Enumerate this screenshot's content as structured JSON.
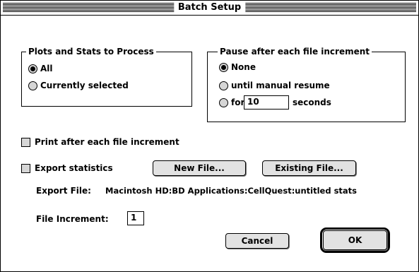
{
  "window": {
    "title": "Batch Setup"
  },
  "plots_group": {
    "legend": "Plots and Stats to Process",
    "options": [
      {
        "label": "All",
        "selected": true
      },
      {
        "label": "Currently selected",
        "selected": false
      }
    ]
  },
  "pause_group": {
    "legend": "Pause after each file increment",
    "none_label": "None",
    "manual_label": "until manual resume",
    "for_label": "for",
    "for_value": "10",
    "seconds_label": "seconds",
    "selected": "None"
  },
  "print_option": {
    "label": "Print after each file increment",
    "checked": false
  },
  "export_option": {
    "label": "Export statistics",
    "checked": false
  },
  "buttons": {
    "new_file": "New File...",
    "existing_file": "Existing File...",
    "cancel": "Cancel",
    "ok": "OK"
  },
  "export_file": {
    "label": "Export File:",
    "path": "Macintosh HD:BD Applications:CellQuest:untitled stats"
  },
  "file_increment": {
    "label": "File Increment:",
    "value": "1"
  },
  "colors": {
    "control_fill": "#d6d6d6",
    "button_fill": "#e2e2e2"
  }
}
